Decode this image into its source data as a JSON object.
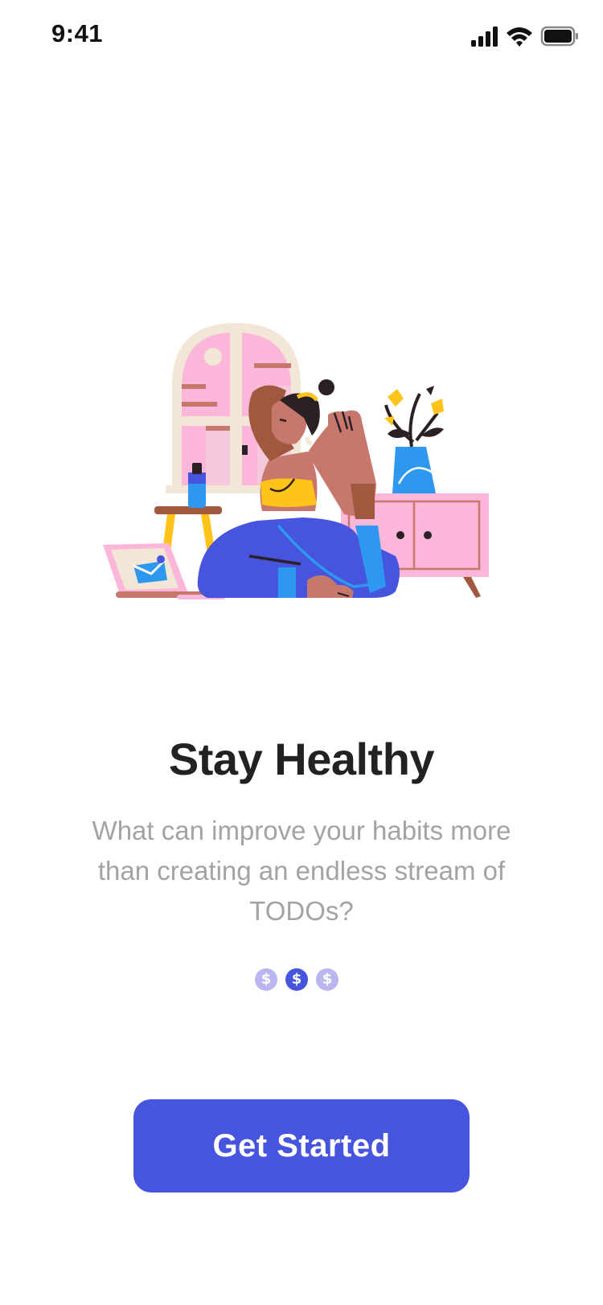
{
  "status_bar": {
    "time": "9:41",
    "icons": [
      "signal-icon",
      "wifi-icon",
      "battery-icon"
    ]
  },
  "illustration": {
    "subject": "yoga-illustration-icon"
  },
  "onboarding": {
    "title": "Stay Healthy",
    "subtitle": "What can improve your habits more than creating an endless stream of TODOs?",
    "pager": {
      "pages": [
        "$",
        "$",
        "$"
      ],
      "active_index": 1
    },
    "cta_label": "Get Started"
  },
  "colors": {
    "primary": "#4755DE",
    "title_text": "#222222",
    "subtitle_text": "#A3A3A3",
    "dot_inactive": "#B9B6F0",
    "dot_active": "#4754DE"
  }
}
